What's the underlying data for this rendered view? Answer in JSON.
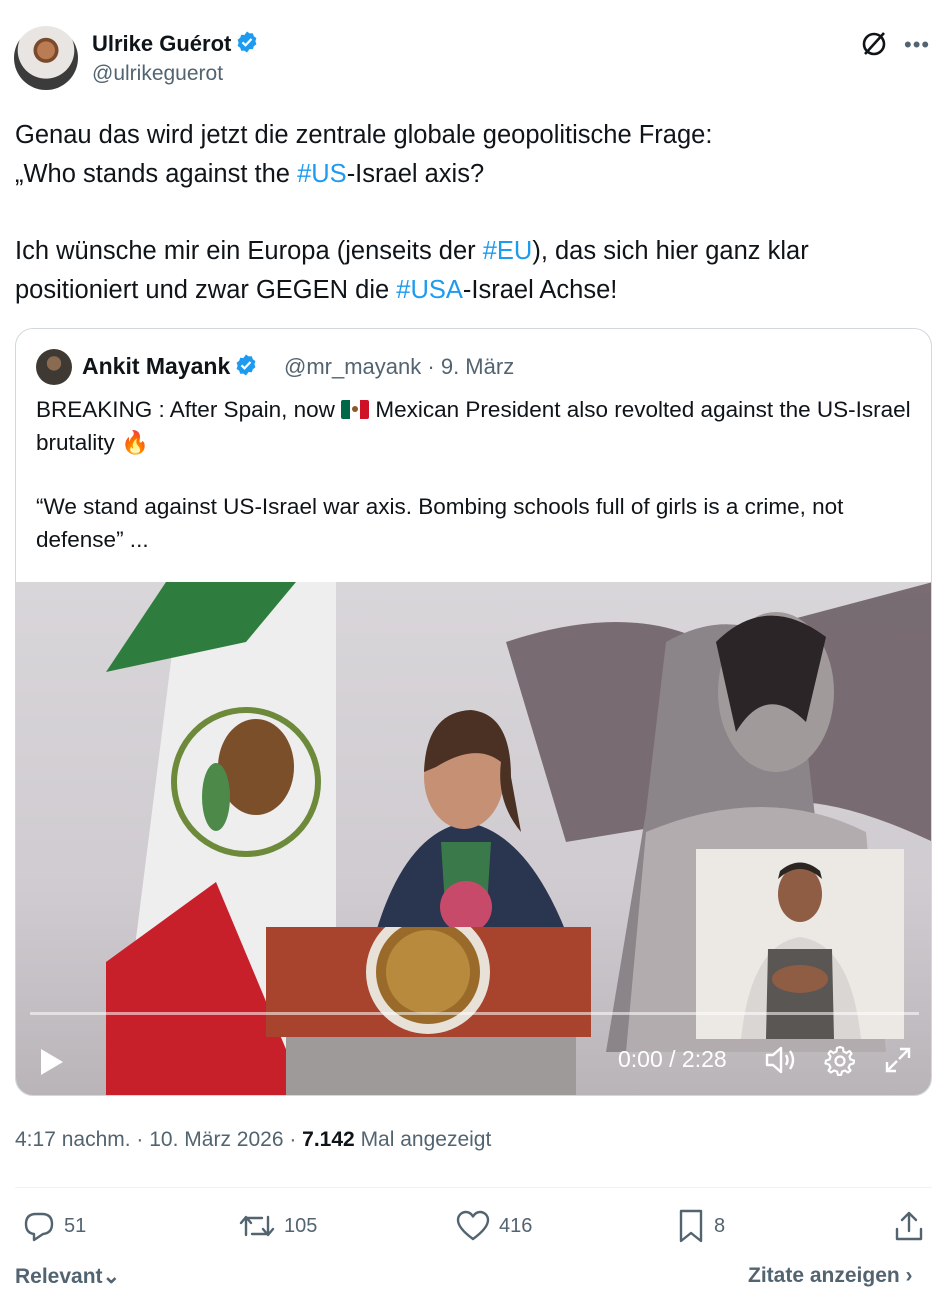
{
  "author": {
    "name": "Ulrike Guérot",
    "handle": "@ulrikeguerot",
    "verified": true
  },
  "tweet": {
    "paragraph1": [
      {
        "text": "Genau das wird jetzt die zentrale globale geopolitische Frage:",
        "hashtag": false
      },
      {
        "text": "„Who stands against the ",
        "hashtag": false
      },
      {
        "text": "#US",
        "hashtag": true
      },
      {
        "text": "-Israel axis?",
        "hashtag": false
      }
    ],
    "paragraph2": [
      {
        "text": "Ich wünsche mir ein Europa (jenseits der ",
        "hashtag": false
      },
      {
        "text": "#EU",
        "hashtag": true
      },
      {
        "text": "), das sich hier ganz klar positioniert und zwar GEGEN die ",
        "hashtag": false
      },
      {
        "text": "#USA",
        "hashtag": true
      },
      {
        "text": "-Israel Achse!",
        "hashtag": false
      }
    ]
  },
  "quote": {
    "name": "Ankit Mayank",
    "verified": true,
    "handle": "@mr_mayank",
    "separator": "·",
    "date": "9. März",
    "line1_a": "BREAKING : After Spain, now ",
    "line1_flag": "mexico-flag-emoji",
    "line1_b": " Mexican President also revolted against the US-Israel brutality ",
    "line1_emoji": "🔥",
    "paragraph2": "“We stand against US-Israel war axis. Bombing schools full of girls is a crime, not defense” ..."
  },
  "video": {
    "time_display": "0:00 / 2:28",
    "progress_fraction": 0.0,
    "icons": [
      "play-icon",
      "volume-icon",
      "settings-gear-icon",
      "fullscreen-expand-icon"
    ]
  },
  "meta": {
    "time": "4:17 nachm.",
    "sep1": " · ",
    "date": "10. März 2026",
    "sep2": " · ",
    "views": "7.142",
    "views_label": " Mal angezeigt"
  },
  "actions": {
    "replies": "51",
    "reposts": "105",
    "likes": "416",
    "bookmarks": "8"
  },
  "footer": {
    "sort_label": "Relevant",
    "sort_chevron": "⌄",
    "quotes_label": "Zitate anzeigen",
    "quotes_chevron": "›"
  },
  "colors": {
    "text": "#0f1419",
    "secondary": "#536471",
    "accent": "#1d9bf0",
    "border": "#cfd9de"
  }
}
